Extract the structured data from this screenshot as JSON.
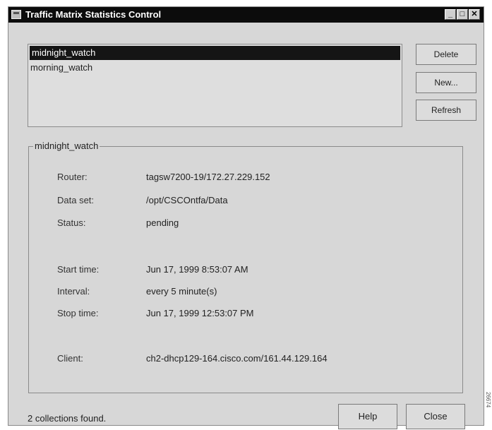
{
  "window": {
    "title": "Traffic Matrix Statistics Control",
    "controls": {
      "minimize": "_",
      "maximize": "□",
      "close": "✕"
    }
  },
  "collections": {
    "items": [
      "midnight_watch",
      "morning_watch"
    ],
    "selected": "midnight_watch"
  },
  "buttons": {
    "delete": "Delete",
    "new": "New...",
    "refresh": "Refresh",
    "help": "Help",
    "close": "Close"
  },
  "details": {
    "group_title": "midnight_watch",
    "router_label": "Router:",
    "router_value": "tagsw7200-19/172.27.229.152",
    "dataset_label": "Data set:",
    "dataset_value": "/opt/CSCOntfa/Data",
    "status_label": "Status:",
    "status_value": "pending",
    "start_label": "Start time:",
    "start_value": "Jun 17, 1999 8:53:07 AM",
    "interval_label": "Interval:",
    "interval_value": "every 5 minute(s)",
    "stop_label": "Stop time:",
    "stop_value": "Jun 17, 1999 12:53:07 PM",
    "client_label": "Client:",
    "client_value": "ch2-dhcp129-164.cisco.com/161.44.129.164"
  },
  "status_text": "2 collections found.",
  "figure_id": "26674"
}
